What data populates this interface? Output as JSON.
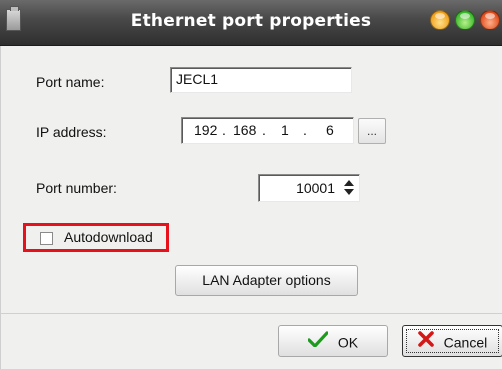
{
  "window": {
    "title": "Ethernet port properties",
    "icon": "window-app-icon",
    "controls": [
      "minimize-button",
      "maximize-button",
      "close-button"
    ]
  },
  "form": {
    "port_name_label": "Port name:",
    "port_name_value": "JECL1",
    "ip_label": "IP address:",
    "ip_octets": [
      "192",
      "168",
      "1",
      "6"
    ],
    "ip_separator": ".",
    "ip_browse_label": "...",
    "port_number_label": "Port number:",
    "port_number_value": "10001",
    "autodownload_label": "Autodownload",
    "autodownload_checked": false,
    "highlight_color": "#e8101a"
  },
  "buttons": {
    "lan_adapter": "LAN Adapter options",
    "ok": "OK",
    "cancel": "Cancel",
    "ok_icon": "checkmark-icon",
    "cancel_icon": "x-cross-icon",
    "ok_icon_color": "#1e9a1e",
    "cancel_icon_color": "#d41818"
  }
}
